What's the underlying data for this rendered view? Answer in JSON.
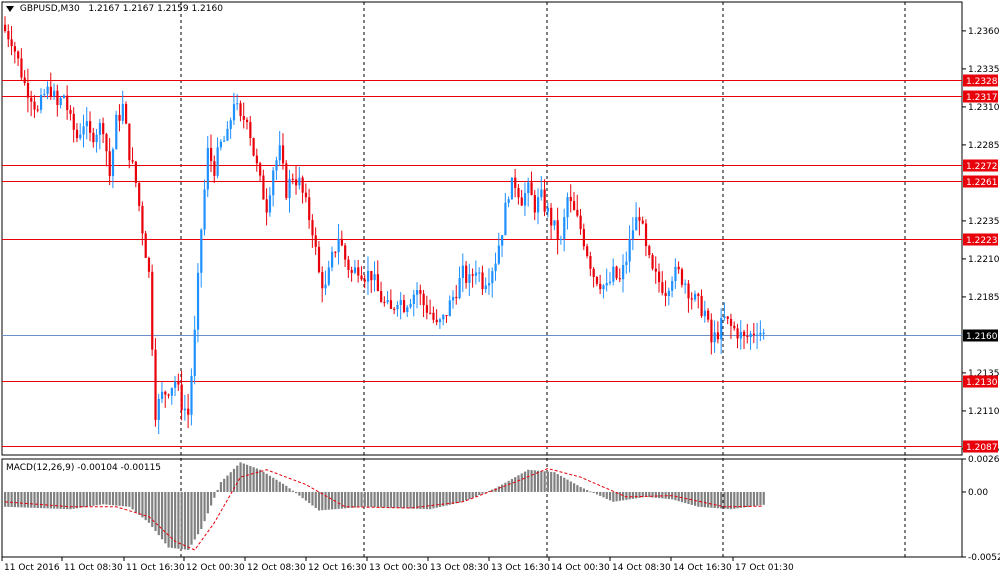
{
  "header": {
    "symbol_tf": "GBPUSD,M30",
    "ohlc": "1.2167 1.2167 1.2159 1.2160"
  },
  "macd_label": {
    "name": "MACD(12,26,9)",
    "values": "-0.00104 -0.00115"
  },
  "colors": {
    "bull": "#1e90ff",
    "bear": "#e8000b",
    "level_line": "#e8000b",
    "price_line": "#6b8fc9",
    "grid": "#000000",
    "hist": "#808080",
    "signal": "#e8000b"
  },
  "chart_data": [
    {
      "type": "candlestick",
      "title": "GBPUSD,M30",
      "ylim": [
        1.2081,
        1.2379
      ],
      "y_tick_labels": [
        "1.2360",
        "1.2335",
        "1.2310",
        "1.2285",
        "1.2235",
        "1.2210",
        "1.2185",
        "1.2135",
        "1.2110",
        "1.2085"
      ],
      "y_ticks": [
        1.236,
        1.2335,
        1.231,
        1.2285,
        1.2235,
        1.221,
        1.2185,
        1.2135,
        1.211,
        1.2085
      ],
      "x_tick_labels": [
        "11 Oct 2016",
        "11 Oct 08:30",
        "11 Oct 16:30",
        "12 Oct 00:30",
        "12 Oct 08:30",
        "12 Oct 16:30",
        "13 Oct 00:30",
        "13 Oct 08:30",
        "13 Oct 16:30",
        "14 Oct 00:30",
        "14 Oct 08:30",
        "14 Oct 16:30",
        "17 Oct 01:30"
      ],
      "levels": [
        {
          "label": "1.2328",
          "value": 1.2328
        },
        {
          "label": "1.2317",
          "value": 1.2317
        },
        {
          "label": "1.2272",
          "value": 1.2272
        },
        {
          "label": "1.2261",
          "value": 1.2261
        },
        {
          "label": "1.2223",
          "value": 1.2223
        },
        {
          "label": "1.2130",
          "value": 1.213
        },
        {
          "label": "1.2087",
          "value": 1.2087
        }
      ],
      "current_price": {
        "label": "1.2160",
        "value": 1.216
      },
      "anchors": [
        [
          0,
          1.236
        ],
        [
          2,
          1.2355
        ],
        [
          4,
          1.234
        ],
        [
          6,
          1.2325
        ],
        [
          8,
          1.2318
        ],
        [
          10,
          1.2306
        ],
        [
          12,
          1.2318
        ],
        [
          14,
          1.2322
        ],
        [
          16,
          1.231
        ],
        [
          18,
          1.2318
        ],
        [
          20,
          1.23
        ],
        [
          22,
          1.229
        ],
        [
          24,
          1.23
        ],
        [
          26,
          1.229
        ],
        [
          28,
          1.2295
        ],
        [
          30,
          1.2298
        ],
        [
          32,
          1.2265
        ],
        [
          34,
          1.23
        ],
        [
          36,
          1.231
        ],
        [
          38,
          1.228
        ],
        [
          40,
          1.226
        ],
        [
          42,
          1.223
        ],
        [
          44,
          1.22
        ],
        [
          46,
          1.211
        ],
        [
          48,
          1.212
        ],
        [
          50,
          1.2125
        ],
        [
          52,
          1.213
        ],
        [
          54,
          1.2115
        ],
        [
          56,
          1.2108
        ],
        [
          58,
          1.216
        ],
        [
          60,
          1.223
        ],
        [
          62,
          1.228
        ],
        [
          64,
          1.227
        ],
        [
          66,
          1.2285
        ],
        [
          68,
          1.229
        ],
        [
          70,
          1.2315
        ],
        [
          72,
          1.23
        ],
        [
          74,
          1.2305
        ],
        [
          76,
          1.228
        ],
        [
          78,
          1.226
        ],
        [
          80,
          1.2245
        ],
        [
          82,
          1.227
        ],
        [
          84,
          1.228
        ],
        [
          86,
          1.2255
        ],
        [
          88,
          1.2265
        ],
        [
          90,
          1.226
        ],
        [
          92,
          1.2245
        ],
        [
          94,
          1.223
        ],
        [
          96,
          1.22
        ],
        [
          98,
          1.219
        ],
        [
          100,
          1.221
        ],
        [
          102,
          1.2225
        ],
        [
          104,
          1.221
        ],
        [
          106,
          1.22
        ],
        [
          108,
          1.2205
        ],
        [
          110,
          1.22
        ],
        [
          112,
          1.22
        ],
        [
          114,
          1.2188
        ],
        [
          116,
          1.218
        ],
        [
          118,
          1.2175
        ],
        [
          120,
          1.2185
        ],
        [
          122,
          1.218
        ],
        [
          124,
          1.2185
        ],
        [
          126,
          1.219
        ],
        [
          128,
          1.218
        ],
        [
          130,
          1.2175
        ],
        [
          132,
          1.2165
        ],
        [
          134,
          1.217
        ],
        [
          136,
          1.218
        ],
        [
          138,
          1.219
        ],
        [
          140,
          1.22
        ],
        [
          142,
          1.2195
        ],
        [
          144,
          1.2205
        ],
        [
          146,
          1.2195
        ],
        [
          148,
          1.22
        ],
        [
          150,
          1.221
        ],
        [
          152,
          1.223
        ],
        [
          154,
          1.2255
        ],
        [
          156,
          1.226
        ],
        [
          158,
          1.225
        ],
        [
          160,
          1.2255
        ],
        [
          162,
          1.2245
        ],
        [
          164,
          1.225
        ],
        [
          166,
          1.224
        ],
        [
          168,
          1.223
        ],
        [
          170,
          1.222
        ],
        [
          172,
          1.225
        ],
        [
          174,
          1.224
        ],
        [
          176,
          1.223
        ],
        [
          178,
          1.2215
        ],
        [
          180,
          1.22
        ],
        [
          182,
          1.2195
        ],
        [
          184,
          1.219
        ],
        [
          186,
          1.22
        ],
        [
          188,
          1.2195
        ],
        [
          190,
          1.221
        ],
        [
          192,
          1.223
        ],
        [
          194,
          1.224
        ],
        [
          196,
          1.2215
        ],
        [
          198,
          1.22
        ],
        [
          200,
          1.2195
        ],
        [
          202,
          1.219
        ],
        [
          204,
          1.22
        ],
        [
          206,
          1.22
        ],
        [
          208,
          1.2195
        ],
        [
          210,
          1.2185
        ],
        [
          212,
          1.218
        ],
        [
          214,
          1.2175
        ],
        [
          216,
          1.2155
        ],
        [
          218,
          1.2162
        ],
        [
          220,
          1.217
        ],
        [
          222,
          1.2165
        ],
        [
          224,
          1.2162
        ],
        [
          226,
          1.2157
        ],
        [
          228,
          1.216
        ],
        [
          230,
          1.2165
        ],
        [
          232,
          1.216
        ]
      ]
    },
    {
      "type": "bar",
      "title": "MACD(12,26,9)",
      "ylim": [
        -0.00527,
        0.00267
      ],
      "y_tick_labels": [
        "0.00267",
        "0.00",
        "-0.00527"
      ],
      "y_ticks": [
        0.00267,
        0.0,
        -0.00527
      ],
      "hist_anchors": [
        [
          0,
          -0.0012
        ],
        [
          20,
          -0.0014
        ],
        [
          30,
          -0.001
        ],
        [
          38,
          -0.0012
        ],
        [
          44,
          -0.0025
        ],
        [
          50,
          -0.0045
        ],
        [
          56,
          -0.0047
        ],
        [
          60,
          -0.003
        ],
        [
          66,
          0.0008
        ],
        [
          72,
          0.0024
        ],
        [
          78,
          0.0018
        ],
        [
          86,
          0.0005
        ],
        [
          96,
          -0.0015
        ],
        [
          110,
          -0.0012
        ],
        [
          130,
          -0.0014
        ],
        [
          140,
          -0.0008
        ],
        [
          150,
          0.0003
        ],
        [
          160,
          0.0018
        ],
        [
          168,
          0.0016
        ],
        [
          176,
          0.0004
        ],
        [
          186,
          -0.0008
        ],
        [
          196,
          -0.0004
        ],
        [
          204,
          -0.0006
        ],
        [
          212,
          -0.0012
        ],
        [
          222,
          -0.0014
        ],
        [
          232,
          -0.00104
        ]
      ],
      "signal_anchors": [
        [
          0,
          -0.0008
        ],
        [
          20,
          -0.0012
        ],
        [
          34,
          -0.0012
        ],
        [
          44,
          -0.002
        ],
        [
          52,
          -0.004
        ],
        [
          58,
          -0.0047
        ],
        [
          64,
          -0.0025
        ],
        [
          72,
          0.0012
        ],
        [
          80,
          0.0018
        ],
        [
          92,
          0.0006
        ],
        [
          104,
          -0.0012
        ],
        [
          124,
          -0.0013
        ],
        [
          140,
          -0.0008
        ],
        [
          156,
          0.0008
        ],
        [
          166,
          0.0019
        ],
        [
          176,
          0.0012
        ],
        [
          190,
          -0.0004
        ],
        [
          204,
          -0.0003
        ],
        [
          220,
          -0.0012
        ],
        [
          232,
          -0.00115
        ]
      ]
    }
  ]
}
